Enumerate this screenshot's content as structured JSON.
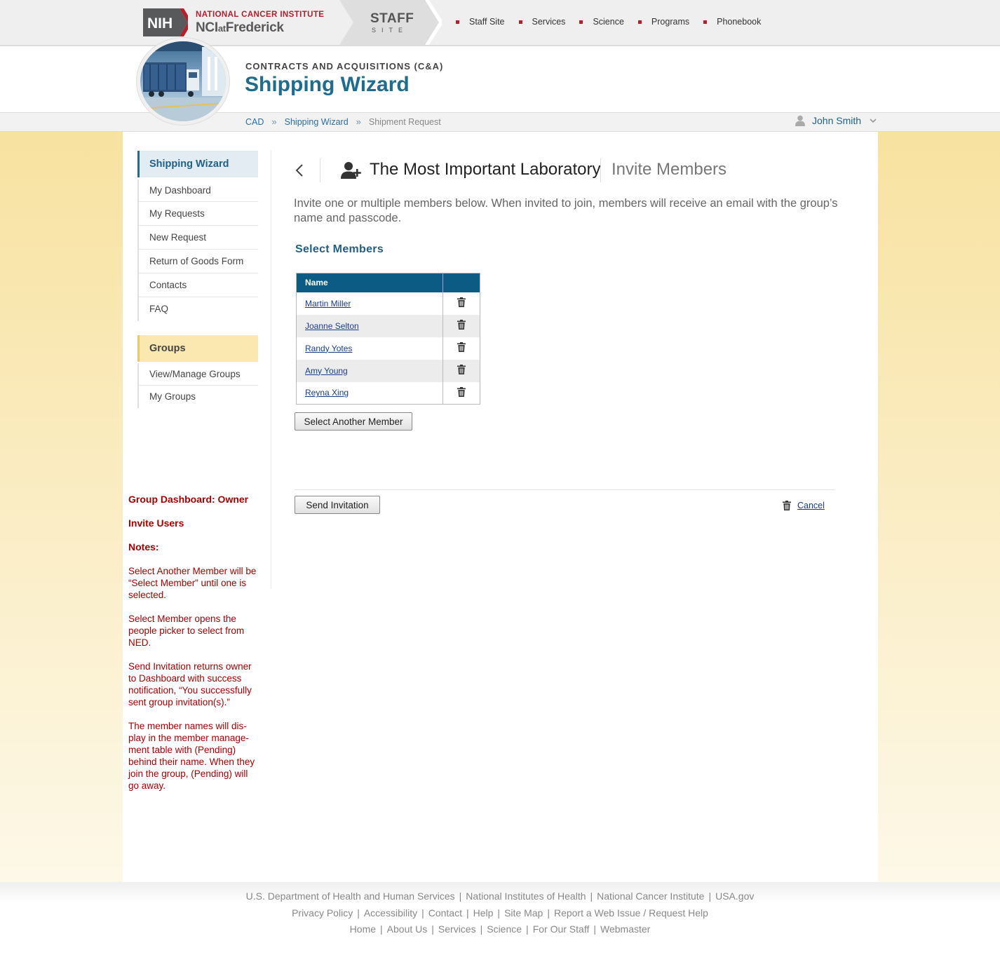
{
  "topbar": {
    "nih_text": "NIH",
    "nci_line1": "NATIONAL CANCER INSTITUTE",
    "nci_line2_a": "NCI",
    "nci_line2_b": "at",
    "nci_line2_c": "Frederick",
    "staff": "STAFF",
    "site": "SITE",
    "nav": [
      "Staff Site",
      "Services",
      "Science",
      "Programs",
      "Phonebook"
    ],
    "accent": "#b21f2d"
  },
  "header": {
    "subtitle": "CONTRACTS AND ACQUISITIONS (C&A)",
    "title": "Shipping Wizard",
    "title_color": "#1f6c8e"
  },
  "breadcrumb": {
    "items": [
      "CAD",
      "Shipping Wizard"
    ],
    "separator": "»",
    "current": "Shipment Request"
  },
  "user": {
    "name": "John Smith",
    "icon": "user-icon"
  },
  "sidebar": {
    "shipping_wizard_heading": "Shipping Wizard",
    "shipping_items": [
      "My Dashboard",
      "My Requests",
      "New Request",
      "Return of Goods Form",
      "Contacts",
      "FAQ"
    ],
    "groups_heading": "Groups",
    "group_items": [
      "View/Manage Groups",
      "My Groups"
    ]
  },
  "notes": {
    "heading1": "Group Dashboard: Owner",
    "heading2": "Invite Users",
    "heading3": "Notes:",
    "paragraphs": [
      "Select Another Member will be “Select Member” until one is selected.",
      "Select Member opens the people picker to select from NED.",
      "Send Invitation returns owner to Dashboard with success notification, “You successfully sent group invitation(s).”",
      "The member names will dis-play in the member manage-ment table with (Pending) behind their name. When they join the group, (Pending) will go away."
    ],
    "color": "#a80000"
  },
  "main": {
    "group_name": "The Most Important Laboratory",
    "page_name": "Invite Members",
    "intro": "Invite one or multiple members below. When invited to join, members will receive an email with the group’s name and passcode.",
    "section_heading": "Select Members",
    "table_header": "Name",
    "members": [
      "Martin Miller",
      "Joanne Selton",
      "Randy Yotes",
      "Amy Young",
      "Reyna Xing"
    ],
    "select_another_label": "Select Another Member",
    "send_label": "Send Invitation",
    "cancel_label": "Cancel"
  },
  "footer": {
    "row1": [
      "U.S. Department of Health and Human Services",
      "National Institutes of Health",
      "National Cancer Institute",
      "USA.gov"
    ],
    "row2": [
      "Privacy Policy",
      "Accessibility",
      "Contact",
      "Help",
      "Site Map",
      "Report a Web Issue / Request Help"
    ],
    "row3": [
      "Home",
      "About Us",
      "Services",
      "Science",
      "For Our Staff",
      "Webmaster"
    ]
  }
}
